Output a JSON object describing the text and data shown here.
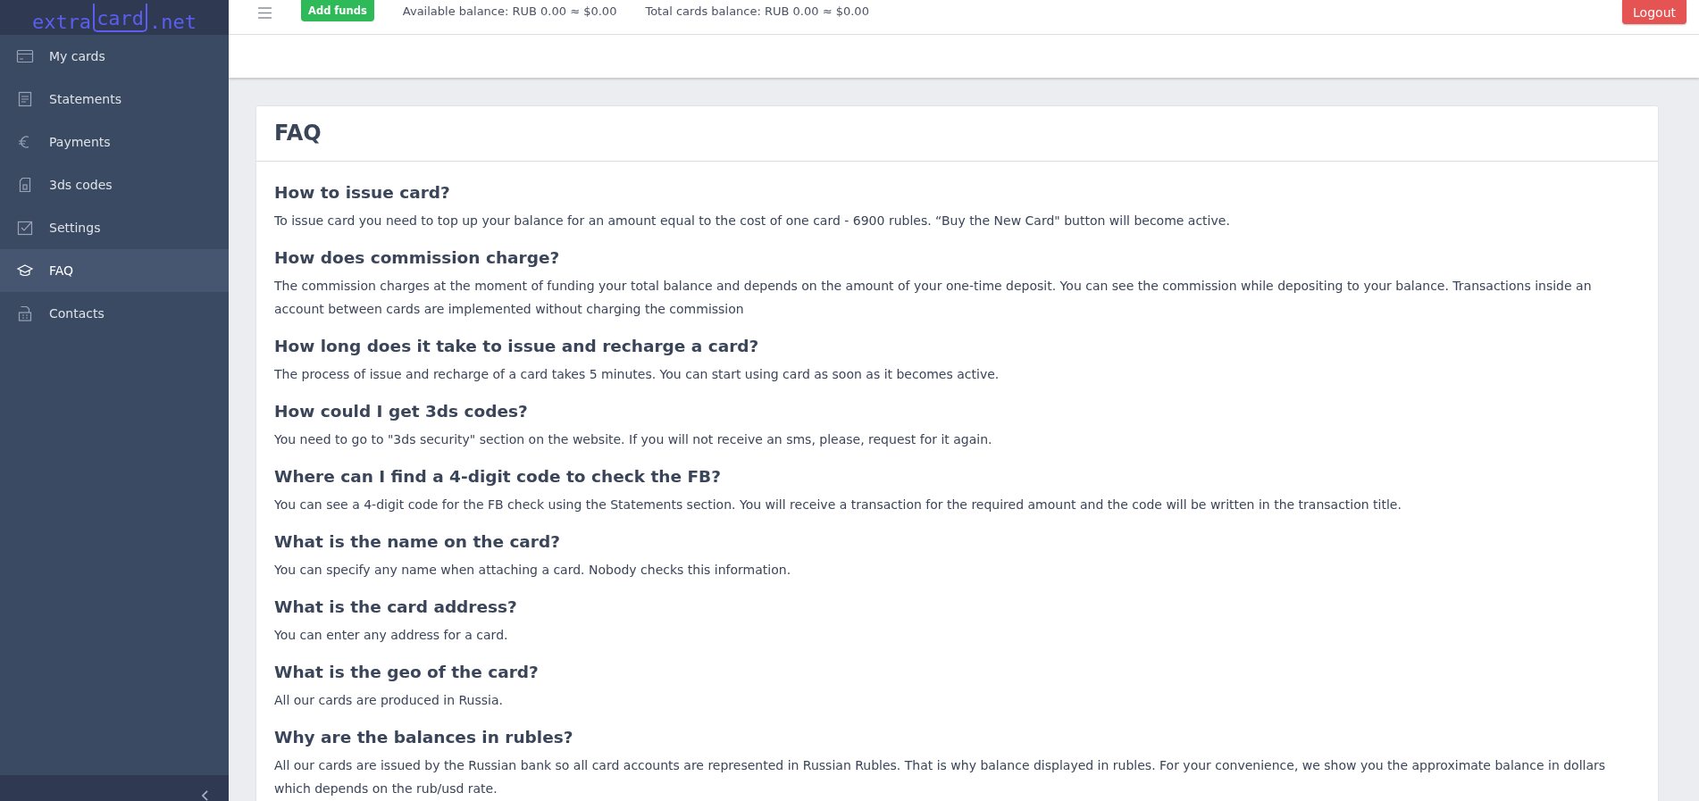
{
  "logo": {
    "parts": [
      "extra",
      "card",
      ".net"
    ]
  },
  "sidebar": {
    "items": [
      {
        "label": "My cards",
        "selected": false
      },
      {
        "label": "Statements",
        "selected": false
      },
      {
        "label": "Payments",
        "selected": false
      },
      {
        "label": "3ds codes",
        "selected": false
      },
      {
        "label": "Settings",
        "selected": false
      },
      {
        "label": "FAQ",
        "selected": true
      },
      {
        "label": "Contacts",
        "selected": false
      }
    ]
  },
  "topbar": {
    "add_funds": "Add funds",
    "available_balance": "Available balance: RUB 0.00 ≈ $0.00",
    "total_balance": "Total cards balance: RUB 0.00 ≈ $0.00",
    "logout": "Logout"
  },
  "faq": {
    "title": "FAQ",
    "items": [
      {
        "question": "How to issue card?",
        "answer": "To issue card you need to top up your balance for an amount equal to the cost of one card - 6900 rubles. “Buy the New Card\" button will become active."
      },
      {
        "question": "How does commission charge?",
        "answer": "The commission charges at the moment of funding your total balance and depends on the amount of your one-time deposit. You can see the commission while depositing to your balance. Transactions inside an account between cards are implemented without charging the commission"
      },
      {
        "question": "How long does it take to issue and recharge a card?",
        "answer": "The process of issue and recharge of a card takes 5 minutes. You can start using card as soon as it becomes active."
      },
      {
        "question": "How could I get 3ds codes?",
        "answer": "You need to go to \"3ds security\" section on the website. If you will not receive an sms, please, request for it again."
      },
      {
        "question": "Where can I find a 4-digit code to check the FB?",
        "answer": "You can see a 4-digit code for the FB check using the Statements section. You will receive a transaction for the required amount and the code will be written in the transaction title."
      },
      {
        "question": "What is the name on the card?",
        "answer": "You can specify any name when attaching a card. Nobody checks this information."
      },
      {
        "question": "What is the card address?",
        "answer": "You can enter any address for a card."
      },
      {
        "question": "What is the geo of the card?",
        "answer": "All our cards are produced in Russia."
      },
      {
        "question": "Why are the balances in rubles?",
        "answer": "All our cards are issued by the Russian bank so all card accounts are represented in Russian Rubles. That is why balance displayed in rubles. For your convenience, we show you the approximate balance in dollars which depends on the rub/usd rate."
      }
    ]
  }
}
